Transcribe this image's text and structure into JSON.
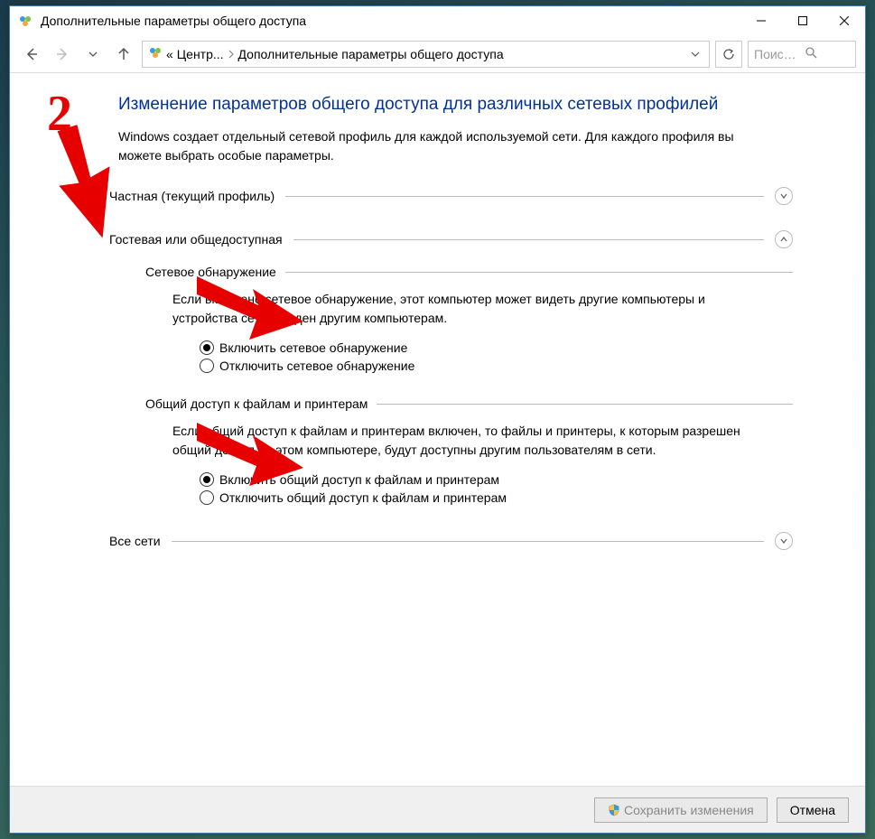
{
  "window": {
    "title": "Дополнительные параметры общего доступа"
  },
  "breadcrumb": {
    "prefix": "«",
    "level1": "Центр...",
    "level2": "Дополнительные параметры общего доступа"
  },
  "search": {
    "placeholder": "Поиск ..."
  },
  "heading": "Изменение параметров общего доступа для различных сетевых профилей",
  "subtext": "Windows создает отдельный сетевой профиль для каждой используемой сети. Для каждого профиля вы можете выбрать особые параметры.",
  "sections": {
    "private": {
      "title": "Частная (текущий профиль)"
    },
    "guest": {
      "title": "Гостевая или общедоступная",
      "network_discovery": {
        "title": "Сетевое обнаружение",
        "desc": "Если включено сетевое обнаружение, этот компьютер может видеть другие компьютеры и устройства сети и виден другим компьютерам.",
        "opt_on": "Включить сетевое обнаружение",
        "opt_off": "Отключить сетевое обнаружение"
      },
      "file_sharing": {
        "title": "Общий доступ к файлам и принтерам",
        "desc": "Если общий доступ к файлам и принтерам включен, то файлы и принтеры, к которым разрешен общий доступ на этом компьютере, будут доступны другим пользователям в сети.",
        "opt_on": "Включить общий доступ к файлам и принтерам",
        "opt_off": "Отключить общий доступ к файлам и принтерам"
      }
    },
    "all": {
      "title": "Все сети"
    }
  },
  "footer": {
    "save": "Сохранить изменения",
    "cancel": "Отмена"
  },
  "annotation": {
    "number": "2"
  }
}
